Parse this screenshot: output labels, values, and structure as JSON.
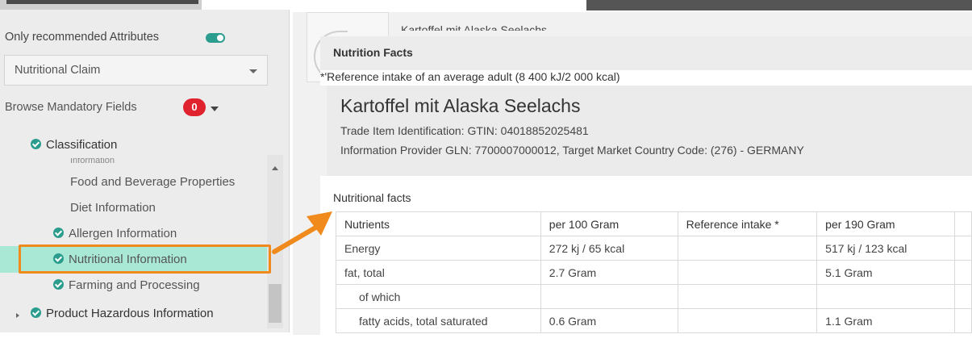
{
  "sidebar": {
    "only_recommended_label": "Only recommended Attributes",
    "select_value": "Nutritional Claim",
    "browse_label": "Browse Mandatory Fields",
    "mandatory_count": "0",
    "classification_label": "Classification",
    "cut_item": "Information",
    "tree": [
      {
        "label": "Food and Beverage Properties",
        "checked": false
      },
      {
        "label": "Diet Information",
        "checked": false
      },
      {
        "label": "Allergen Information",
        "checked": true
      },
      {
        "label": "Nutritional Information",
        "checked": true,
        "selected": true
      },
      {
        "label": "Farming and Processing",
        "checked": true
      },
      {
        "label": "Product Hazardous Information",
        "checked": true
      }
    ]
  },
  "main": {
    "bg_title": "Kartoffel mit Alaska Seelachs",
    "nutrition_facts_title": "Nutrition Facts",
    "reference_note": "*'Reference intake of an average adult (8 400 kJ/2 000 kcal)",
    "product_name": "Kartoffel mit Alaska Seelachs",
    "gtin_line": "Trade Item Identification: GTIN: 04018852025481",
    "gln_line": "Information Provider GLN: 7700007000012, Target Market Country Code: (276) - GERMANY",
    "nutritional_facts_label": "Nutritional facts",
    "table": {
      "headers": [
        "Nutrients",
        "per 100 Gram",
        "Reference intake *",
        "per 190 Gram"
      ],
      "rows": [
        [
          "Energy",
          "272 kj / 65 kcal",
          "",
          "517 kj / 123 kcal"
        ],
        [
          "fat, total",
          "2.7 Gram",
          "",
          "5.1 Gram"
        ],
        [
          "of which",
          "",
          "",
          ""
        ],
        [
          "fatty acids, total saturated",
          "0.6 Gram",
          "",
          "1.1 Gram"
        ]
      ]
    }
  },
  "colors": {
    "accent": "#2a9d8f",
    "highlight": "#a9e8d4",
    "callout": "#f08a1c",
    "badge": "#e0212e"
  }
}
